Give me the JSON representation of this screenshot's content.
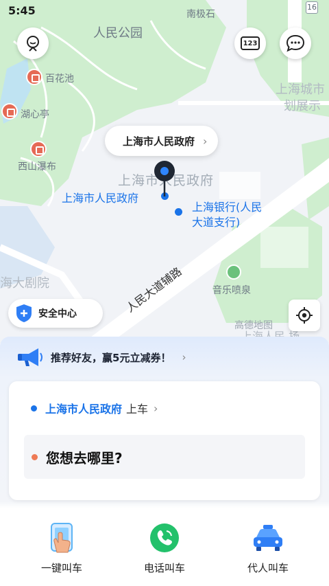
{
  "status_bar": {
    "time": "5:45"
  },
  "map": {
    "labels": {
      "nanjishi": "南极石",
      "people_park": "人民公园",
      "baihuachi": "百花池",
      "huxinting": "湖心亭",
      "xishan_waterfall": "西山瀑布",
      "urban_planning_1": "上海城市",
      "urban_planning_2": "划展示",
      "gov_building_faint": "上海市人民政府",
      "gov_blue": "上海市人民政府",
      "bank_line1": "上海银行(人民",
      "bank_line2": "大道支行)",
      "grand_theatre": "海大剧院",
      "music_fountain": "音乐喷泉",
      "road": "人民大道辅路",
      "gaode": "高德地图",
      "bottom_right_faint": "上海人民 扬",
      "route_badge": "16"
    },
    "selected_location": "上海市人民政府",
    "safety_center": "安全中心"
  },
  "header_buttons": {
    "avatar": "avatar-icon",
    "keyboard_badge": "123",
    "messages": "message-icon"
  },
  "promo": {
    "text": "推荐好友，赢5元立减券！"
  },
  "trip": {
    "pickup_place": "上海市人民政府",
    "pickup_suffix": "上车",
    "destination_prompt": "您想去哪里?"
  },
  "actions": [
    {
      "label": "一键叫车",
      "icon": "hand-tap-icon"
    },
    {
      "label": "电话叫车",
      "icon": "phone-icon"
    },
    {
      "label": "代人叫车",
      "icon": "taxi-icon"
    }
  ],
  "colors": {
    "accent_blue": "#1a73e8",
    "dest_dot": "#ee7a55",
    "poi_red": "#e56a55",
    "park_green": "#cdeccf"
  }
}
